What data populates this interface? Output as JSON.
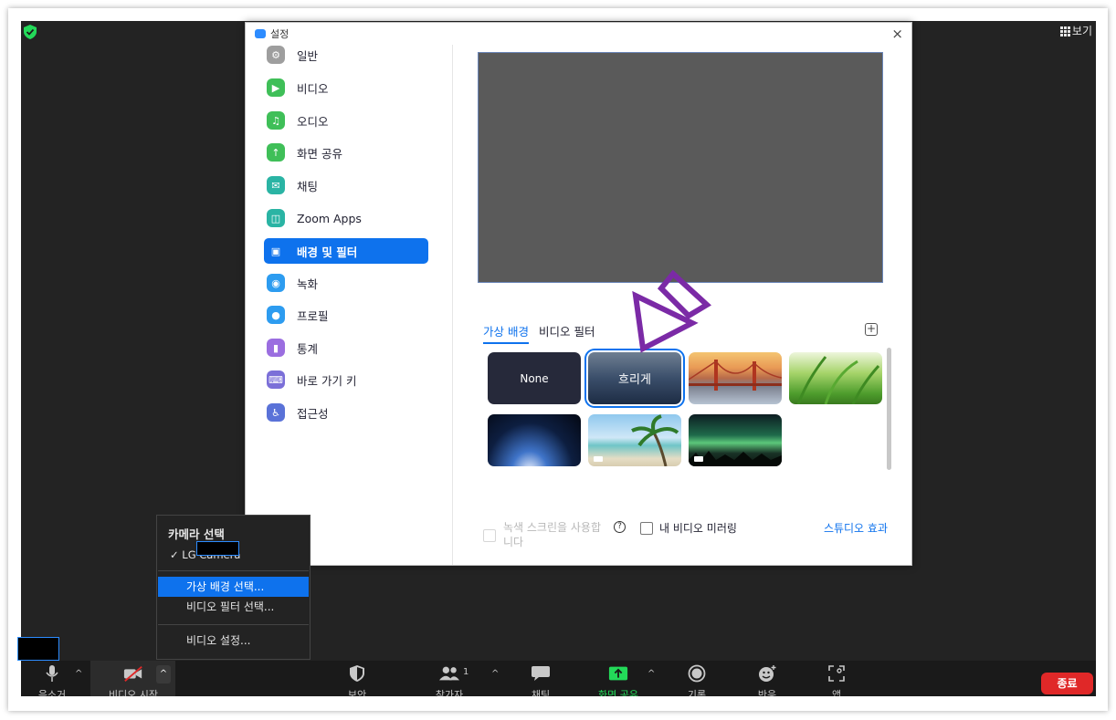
{
  "top": {
    "view_label": "보기"
  },
  "dialog": {
    "title": "설정",
    "close": "×",
    "nav": [
      {
        "label": "일반",
        "icon": "gear-icon",
        "color": "#9e9e9e",
        "glyph": "⚙"
      },
      {
        "label": "비디오",
        "icon": "video-camera-icon",
        "color": "#3fbf58",
        "glyph": "▶"
      },
      {
        "label": "오디오",
        "icon": "headphones-icon",
        "color": "#3fbf58",
        "glyph": "♫"
      },
      {
        "label": "화면 공유",
        "icon": "share-screen-icon",
        "color": "#3fbf58",
        "glyph": "↑"
      },
      {
        "label": "채팅",
        "icon": "chat-bubble-icon",
        "color": "#2ab4a4",
        "glyph": "✉"
      },
      {
        "label": "Zoom Apps",
        "icon": "apps-icon",
        "color": "#2ab4a4",
        "glyph": "◫"
      },
      {
        "label": "배경 및 필터",
        "icon": "background-portrait-icon",
        "color": "#0e72ed",
        "glyph": "▣"
      },
      {
        "label": "녹화",
        "icon": "record-icon",
        "color": "#2d9cf0",
        "glyph": "◉"
      },
      {
        "label": "프로필",
        "icon": "profile-person-icon",
        "color": "#2d9cf0",
        "glyph": "●"
      },
      {
        "label": "통계",
        "icon": "statistics-icon",
        "color": "#9b6ee0",
        "glyph": "▮"
      },
      {
        "label": "바로 가기 키",
        "icon": "keyboard-icon",
        "color": "#7b6fd8",
        "glyph": "⌨"
      },
      {
        "label": "접근성",
        "icon": "accessibility-icon",
        "color": "#5a72d8",
        "glyph": "♿"
      }
    ],
    "active_index": 6,
    "tabs": [
      "가상 배경",
      "비디오 필터"
    ],
    "add_icon": "+",
    "thumbs": [
      {
        "label": "None"
      },
      {
        "label": "흐리게"
      },
      {
        "label": ""
      },
      {
        "label": ""
      },
      {
        "label": ""
      },
      {
        "label": ""
      },
      {
        "label": ""
      }
    ],
    "greenscreen_label": "녹색 스크린을 사용합니다",
    "help": "?",
    "mirror_label": "내 비디오 미러링",
    "studio_label": "스튜디오 효과"
  },
  "menu": {
    "header": "카메라 선택",
    "check": "✓",
    "camera": "LG Camera",
    "items": [
      "가상 배경 선택...",
      "비디오 필터 선택...",
      "비디오 설정..."
    ]
  },
  "toolbar": {
    "audio": "음소거",
    "video": "비디오 시작",
    "security": "보안",
    "participants": "참가자",
    "participants_count": "1",
    "chat": "채팅",
    "share": "화면 공유",
    "record": "기록",
    "reactions": "반응",
    "apps": "앱",
    "end": "종료",
    "caret": "^"
  },
  "colors": {
    "accent": "#0e72ed",
    "end": "#e02828",
    "share": "#23d959"
  }
}
